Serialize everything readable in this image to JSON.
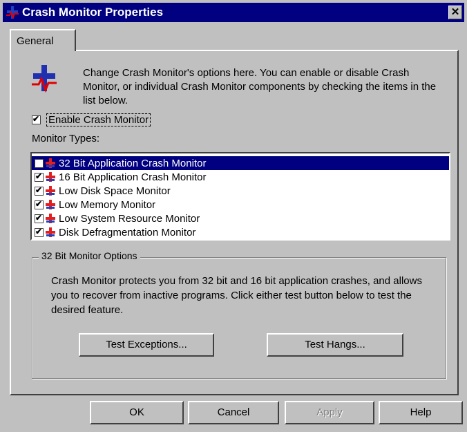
{
  "window": {
    "title": "Crash Monitor Properties",
    "close_glyph": "✕"
  },
  "tabs": [
    {
      "label": "General"
    }
  ],
  "description": "Change Crash Monitor's options here. You can enable or disable Crash Monitor, or individual Crash Monitor components by checking the items in the list below.",
  "enable": {
    "label": "Enable Crash Monitor",
    "checked": true
  },
  "types": {
    "label": "Monitor Types:",
    "items": [
      {
        "label": "32 Bit Application Crash Monitor",
        "checked": true,
        "selected": true
      },
      {
        "label": "16 Bit Application Crash Monitor",
        "checked": true,
        "selected": false
      },
      {
        "label": "Low Disk Space Monitor",
        "checked": true,
        "selected": false
      },
      {
        "label": "Low Memory Monitor",
        "checked": true,
        "selected": false
      },
      {
        "label": "Low System Resource Monitor",
        "checked": true,
        "selected": false
      },
      {
        "label": "Disk Defragmentation Monitor",
        "checked": true,
        "selected": false
      }
    ]
  },
  "options_group": {
    "title": "32 Bit Monitor Options",
    "text": "Crash Monitor protects you from 32 bit and 16 bit application crashes, and allows you to recover from inactive programs. Click either test button below to test the desired feature.",
    "test_exceptions_label": "Test Exceptions...",
    "test_hangs_label": "Test Hangs..."
  },
  "footer": {
    "ok_label": "OK",
    "cancel_label": "Cancel",
    "apply_label": "Apply",
    "help_label": "Help"
  },
  "colors": {
    "titlebar": "#000080",
    "face": "#c0c0c0",
    "selection": "#000080"
  },
  "icons": [
    "crash-monitor-icon",
    "close-icon",
    "checkbox-check-icon"
  ]
}
